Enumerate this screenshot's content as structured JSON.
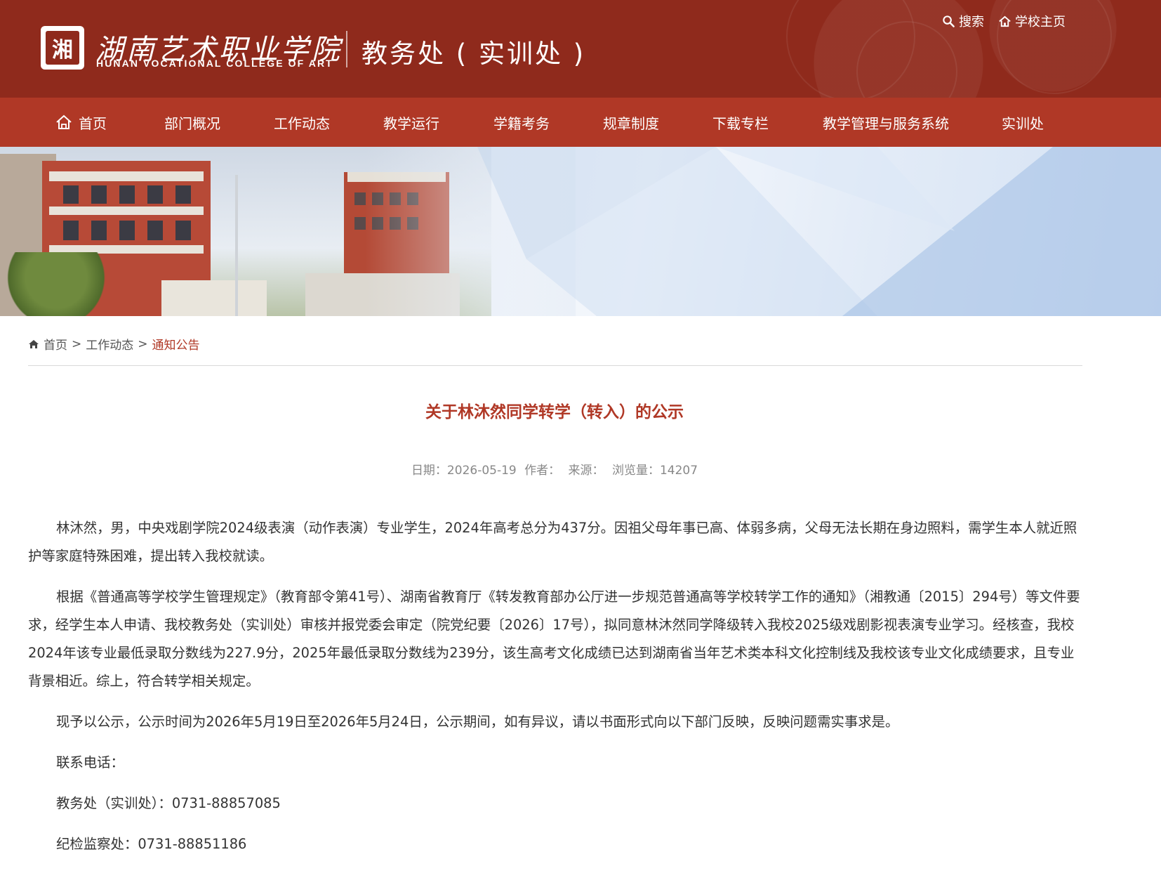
{
  "header": {
    "logo_seal": "湘",
    "college_cn": "湖南艺术职业学院",
    "college_en": "HUNAN VOCATIONAL COLLEGE OF ART",
    "dept_title": "教务处 ( 实训处 )",
    "search_label": "搜索",
    "home_label": "学校主页"
  },
  "nav": {
    "items": [
      "首页",
      "部门概况",
      "工作动态",
      "教学运行",
      "学籍考务",
      "规章制度",
      "下载专栏",
      "教学管理与服务系统",
      "实训处"
    ]
  },
  "breadcrumb": {
    "home": "首页",
    "sep1": ">",
    "level2": "工作动态",
    "sep2": ">",
    "current": "通知公告"
  },
  "article": {
    "title": "关于林沐然同学转学（转入）的公示",
    "meta": {
      "date": "日期：2026-05-19",
      "author": "作者：",
      "source": "来源：",
      "views": "浏览量：14207"
    },
    "paragraphs": [
      "林沐然，男，中央戏剧学院2024级表演（动作表演）专业学生，2024年高考总分为437分。因祖父母年事已高、体弱多病，父母无法长期在身边照料，需学生本人就近照护等家庭特殊困难，提出转入我校就读。",
      "根据《普通高等学校学生管理规定》（教育部令第41号）、湖南省教育厅《转发教育部办公厅进一步规范普通高等学校转学工作的通知》（湘教通〔2015〕294号）等文件要求，经学生本人申请、我校教务处（实训处）审核并报党委会审定（院党纪要〔2026〕17号），拟同意林沐然同学降级转入我校2025级戏剧影视表演专业学习。经核查，我校2024年该专业最低录取分数线为227.9分，2025年最低录取分数线为239分，该生高考文化成绩已达到湖南省当年艺术类本科文化控制线及我校该专业文化成绩要求，且专业背景相近。综上，符合转学相关规定。",
      "现予以公示，公示时间为2026年5月19日至2026年5月24日，公示期间，如有异议，请以书面形式向以下部门反映，反映问题需实事求是。"
    ],
    "contact_label": "联系电话：",
    "contact_1": "教务处（实训处）：0731-88857085",
    "contact_2": "纪检监察处：0731-88851186"
  }
}
